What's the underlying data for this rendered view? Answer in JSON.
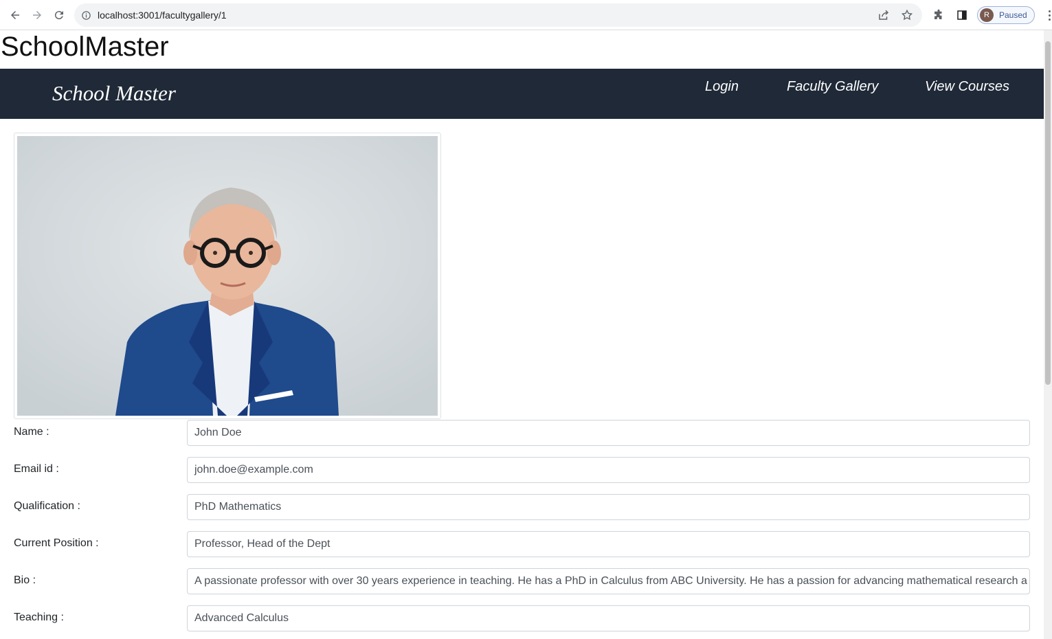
{
  "browser": {
    "url": "localhost:3001/facultygallery/1",
    "profile_initial": "R",
    "profile_status": "Paused"
  },
  "site": {
    "title": "SchoolMaster",
    "brand": "School Master",
    "nav": [
      "Login",
      "Faculty Gallery",
      "View Courses"
    ]
  },
  "faculty": {
    "fields": [
      {
        "label": "Name :",
        "value": "John Doe"
      },
      {
        "label": "Email id :",
        "value": "john.doe@example.com"
      },
      {
        "label": "Qualification :",
        "value": "PhD Mathematics"
      },
      {
        "label": "Current Position :",
        "value": "Professor, Head of the Dept"
      },
      {
        "label": "Bio :",
        "value": "A passionate professor with over 30 years experience in teaching. He has a PhD in Calculus from ABC University. He has a passion for advancing mathematical research a"
      },
      {
        "label": "Teaching :",
        "value": "Advanced Calculus"
      }
    ]
  },
  "colors": {
    "navbar": "#1f2937",
    "suit": "#1f4a8c",
    "photo_background": "#d6dcdf"
  }
}
